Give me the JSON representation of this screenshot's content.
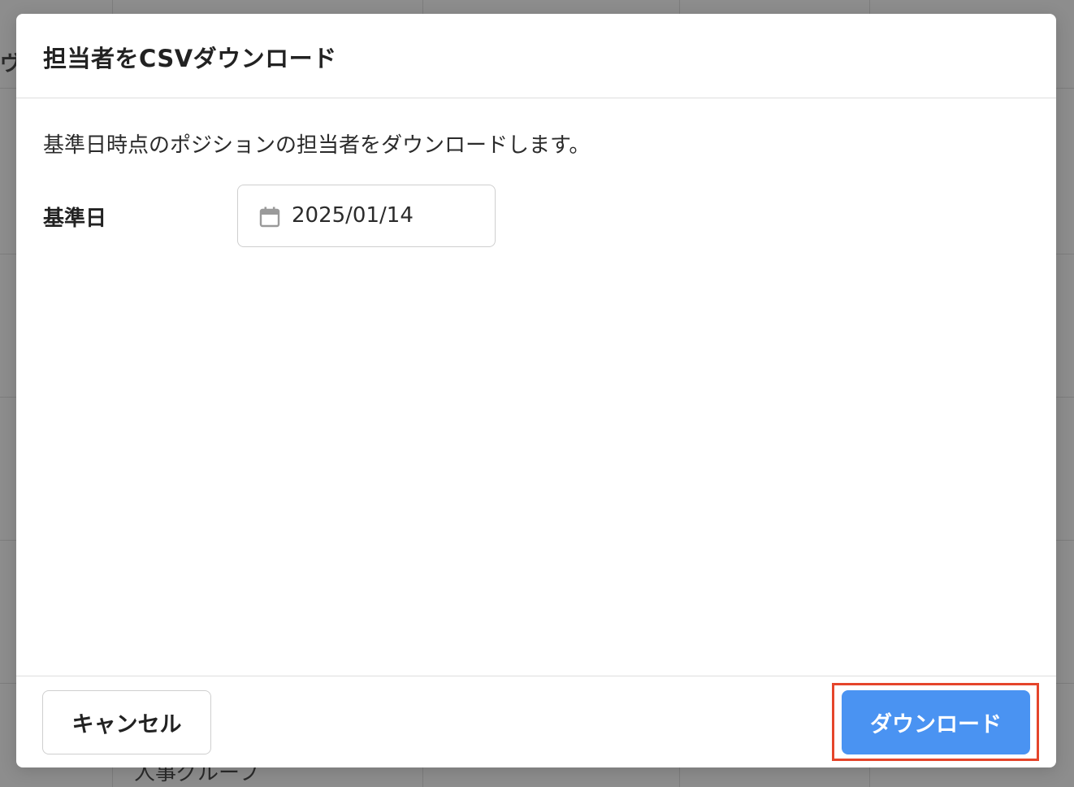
{
  "background": {
    "left_fragment": "ヴ",
    "bottom_cell_text": "人事グループ"
  },
  "dialog": {
    "title": "担当者をCSVダウンロード",
    "description": "基準日時点のポジションの担当者をダウンロードします。",
    "date_field": {
      "label": "基準日",
      "value": "2025/01/14",
      "icon": "calendar-icon"
    },
    "cancel_label": "キャンセル",
    "download_label": "ダウンロード"
  },
  "colors": {
    "primary_button": "#4a93f2",
    "highlight": "#e5452b",
    "overlay": "#8d8d8d"
  }
}
